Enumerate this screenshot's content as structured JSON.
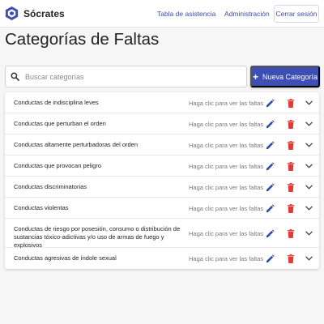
{
  "app": {
    "name": "Sócrates"
  },
  "nav": {
    "attendance_label": "Tabla de asistencia",
    "admin_label": "Administración",
    "logout_label": "Cerrar sesión"
  },
  "page": {
    "title": "Categorías de Faltas"
  },
  "search": {
    "placeholder": "Buscar categorías",
    "value": ""
  },
  "add_button": {
    "label": "Nueva Categoría"
  },
  "hint_text": "Haga clic para ver las faltas",
  "categories": [
    {
      "name": "Conductas de indisciplina leves"
    },
    {
      "name": "Conductas que perturban el orden"
    },
    {
      "name": "Conductas altamente perturbadoras del orden"
    },
    {
      "name": "Conductas que provocan peligro"
    },
    {
      "name": "Conductas discriminatorias"
    },
    {
      "name": "Conductas violentas"
    },
    {
      "name": "Conductas de riesgo por posesión, consumo o distribución de sustancias tóxico-adictivas y/o uso de armas de fuego y explosivos"
    },
    {
      "name": "Conductas agresivas de índole sexual"
    }
  ],
  "icons": {
    "logo": "brand-logo-icon",
    "search": "search-icon",
    "add": "plus-icon",
    "edit": "pencil-icon",
    "delete": "trash-icon",
    "expand": "chevron-down-icon"
  },
  "colors": {
    "primary": "#3d4fb5",
    "link": "#3f4aa8",
    "edit_icon": "#2f4aa8",
    "delete_icon": "#e53935",
    "background": "#f6f6f7"
  }
}
